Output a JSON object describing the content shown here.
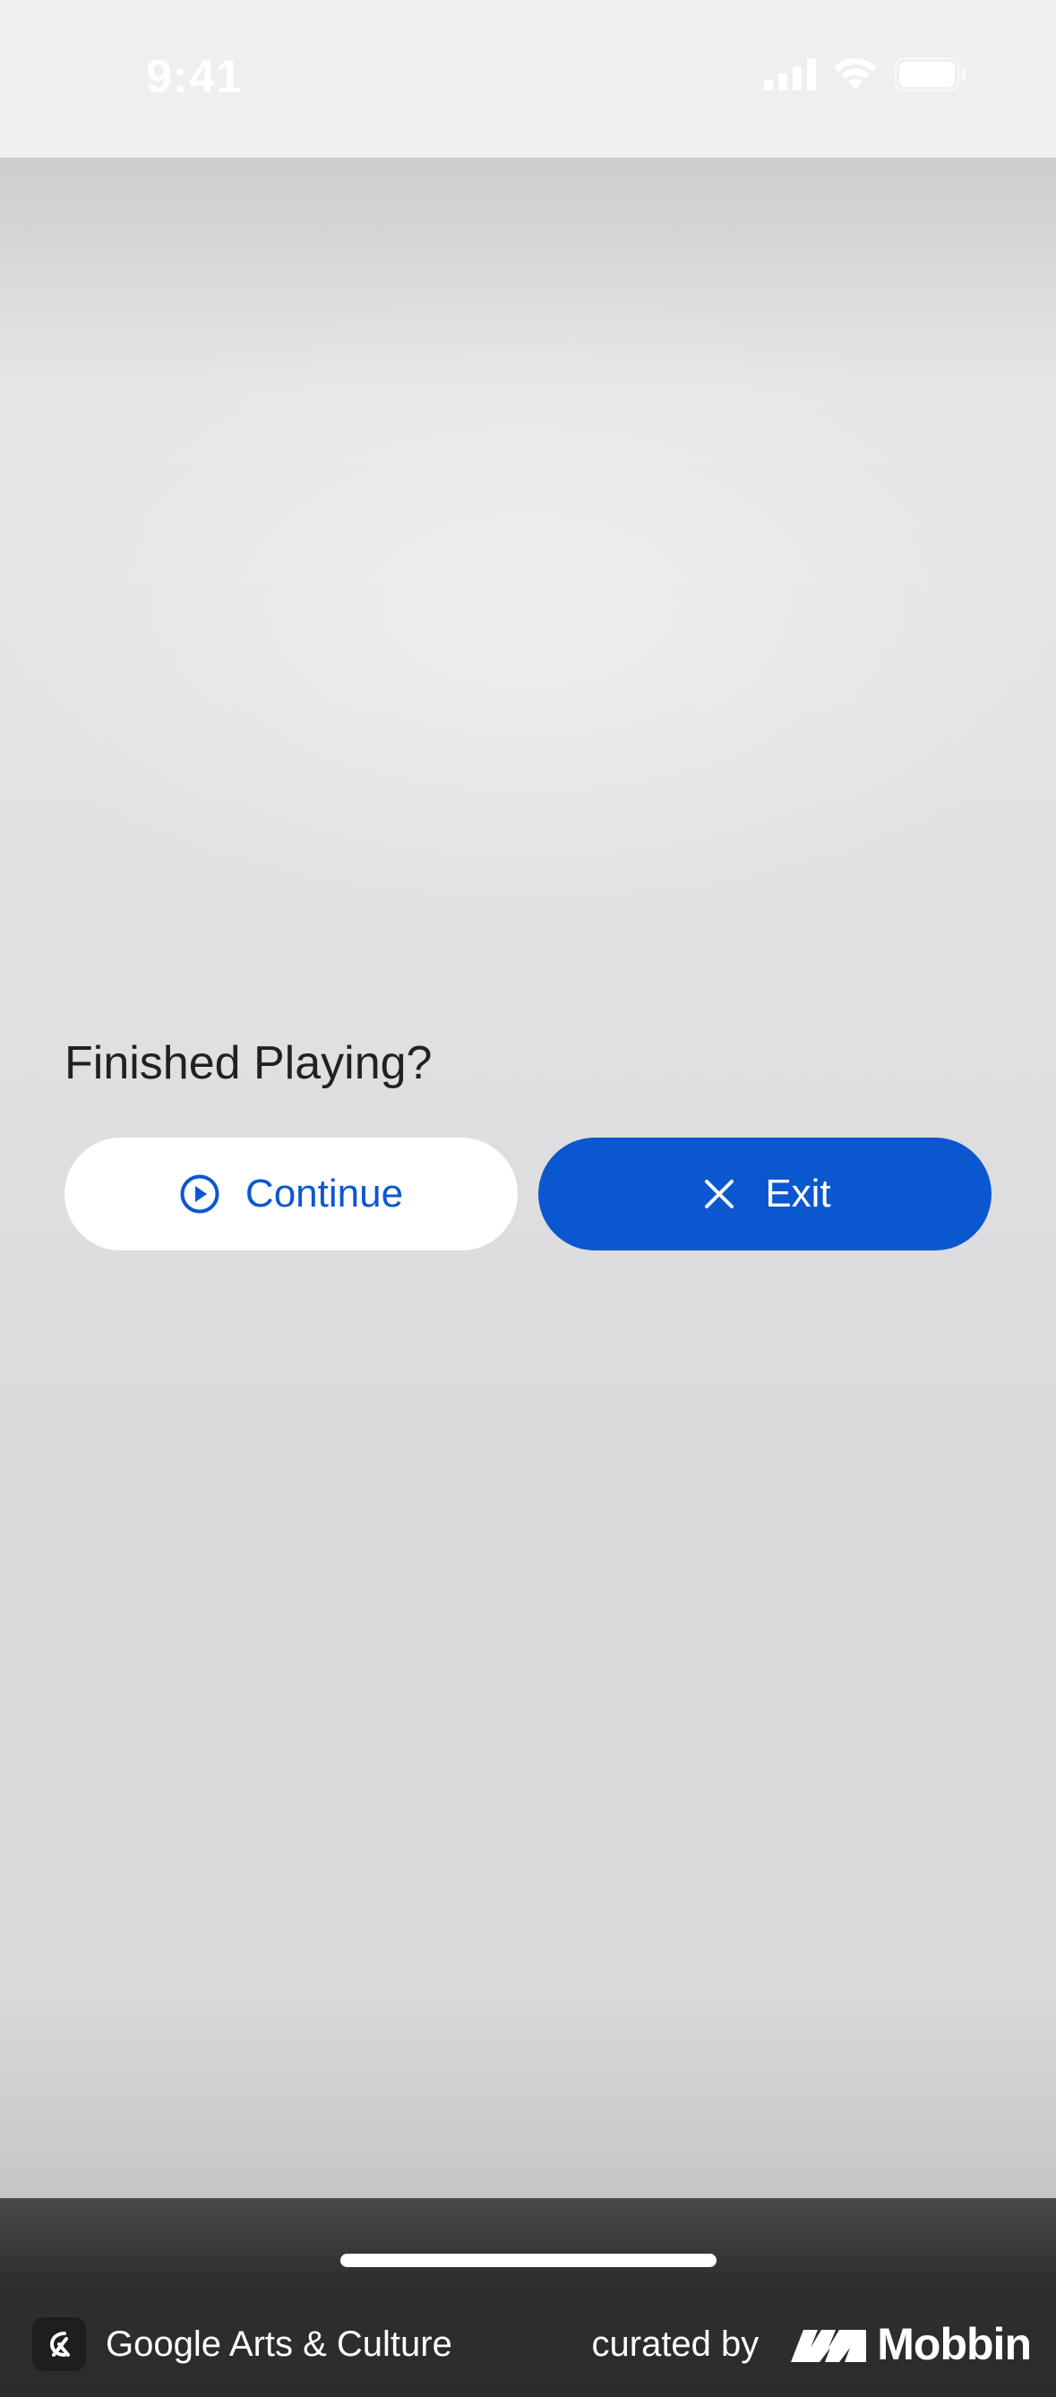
{
  "status_bar": {
    "time": "9:41",
    "icons": [
      "signal-icon",
      "wifi-icon",
      "battery-icon"
    ]
  },
  "dialog": {
    "title": "Finished Playing?",
    "continue_label": "Continue",
    "continue_icon": "play-circle-icon",
    "exit_label": "Exit",
    "exit_icon": "close-icon"
  },
  "footer": {
    "app_name": "Google Arts & Culture",
    "curated_by": "curated by",
    "curator": "Mobbin"
  },
  "colors": {
    "accent": "#0b57d0",
    "footer_bg": "#2b2b2c"
  }
}
